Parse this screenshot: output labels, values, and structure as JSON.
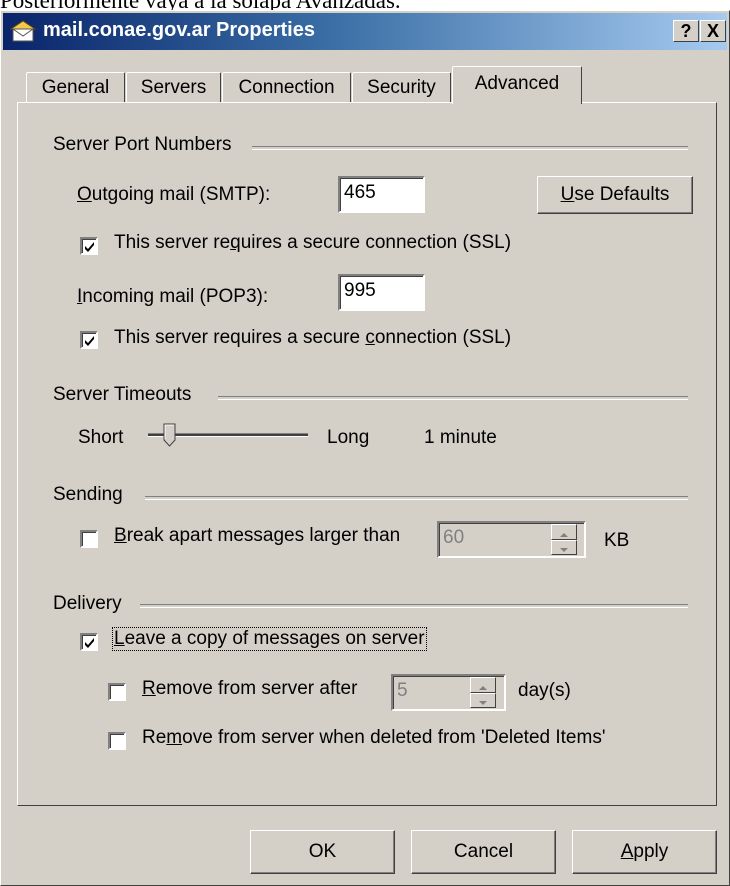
{
  "page_text": "Posteriormente vaya a la solapa Avanzadas.",
  "window": {
    "title": "mail.conae.gov.ar Properties",
    "help_button": "?",
    "close_button": "X",
    "title_gradient": [
      "#0a246a",
      "#a6caf0"
    ]
  },
  "tabs": [
    "General",
    "Servers",
    "Connection",
    "Security",
    "Advanced"
  ],
  "active_tab": "Advanced",
  "server_ports": {
    "group_label": "Server Port Numbers",
    "smtp_label_mnemonic": "O",
    "smtp_label_rest": "utgoing mail (SMTP):",
    "smtp_value": "465",
    "use_defaults_mnemonic": "U",
    "use_defaults_rest": "se Defaults",
    "ssl_smtp_pre": "This server re",
    "ssl_smtp_mnemonic": "q",
    "ssl_smtp_post": "uires a secure connection (SSL)",
    "ssl_smtp_checked": true,
    "pop3_label_mnemonic": "I",
    "pop3_label_rest": "ncoming mail (POP3):",
    "pop3_value": "995",
    "ssl_pop3_pre": "This server requires a secure ",
    "ssl_pop3_mnemonic": "c",
    "ssl_pop3_post": "onnection (SSL)",
    "ssl_pop3_checked": true
  },
  "timeouts": {
    "group_label": "Server Timeouts",
    "short_label": "Short",
    "long_label": "Long",
    "value_text": "1 minute",
    "slider_position": 0.1
  },
  "sending": {
    "group_label": "Sending",
    "break_mnemonic": "B",
    "break_rest": "reak apart messages larger than",
    "break_checked": false,
    "size_value": "60",
    "size_unit": "KB"
  },
  "delivery": {
    "group_label": "Delivery",
    "leave_copy_mnemonic": "L",
    "leave_copy_rest": "eave a copy of messages on server",
    "leave_copy_checked": true,
    "remove_after_mnemonic": "R",
    "remove_after_rest": "emove from server after",
    "remove_after_checked": false,
    "days_value": "5",
    "days_unit": "day(s)",
    "remove_deleted_pre": "Re",
    "remove_deleted_mnemonic": "m",
    "remove_deleted_post": "ove from server when deleted from 'Deleted Items'",
    "remove_deleted_checked": false
  },
  "buttons": {
    "ok": "OK",
    "cancel": "Cancel",
    "apply_mnemonic": "A",
    "apply_rest": "pply"
  }
}
